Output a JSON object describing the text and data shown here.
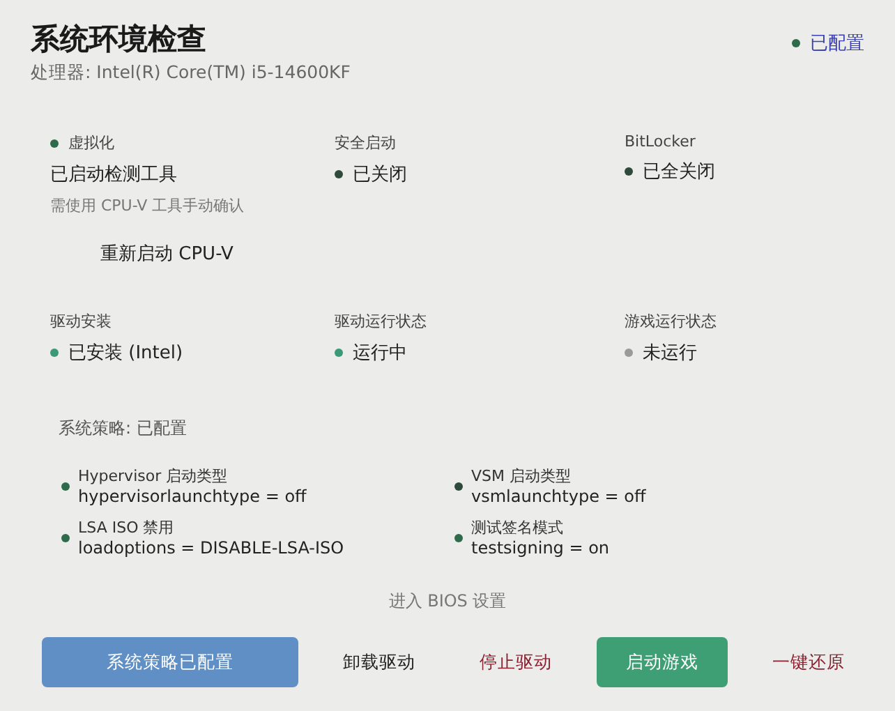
{
  "header": {
    "title": "系统环境检查",
    "processor": "处理器: Intel(R) Core(TM) i5-14600KF",
    "status": {
      "label": "已配置",
      "color": "#2e6b4a"
    }
  },
  "checks": [
    {
      "kind": "label_dot",
      "label": "虚拟化",
      "color": "#2e6b4a",
      "value": "已启动检测工具",
      "note": "需使用 CPU-V 工具手动确认",
      "action": "重新启动 CPU-V"
    },
    {
      "label": "安全启动",
      "value": "已关闭",
      "color": "#2e4a3a"
    },
    {
      "label": "BitLocker",
      "value": "已全关闭",
      "color": "#2e4a3a"
    },
    {
      "label": "驱动安装",
      "value": "已安装 (Intel)",
      "color": "#3a9a78"
    },
    {
      "label": "驱动运行状态",
      "value": "运行中",
      "color": "#3a9a78"
    },
    {
      "label": "游戏运行状态",
      "value": "未运行",
      "color": "#9a9a9a"
    }
  ],
  "policy": {
    "title": "系统策略: 已配置",
    "items": [
      {
        "name": "Hypervisor 启动类型",
        "value": "hypervisorlaunchtype = off",
        "color": "#2e6b4a"
      },
      {
        "name": "VSM 启动类型",
        "value": "vsmlaunchtype = off",
        "color": "#2e4a3a"
      },
      {
        "name": "LSA ISO 禁用",
        "value": "loadoptions = DISABLE-LSA-ISO",
        "color": "#2e6b4a"
      },
      {
        "name": "测试签名模式",
        "value": "testsigning = on",
        "color": "#2e6b4a"
      }
    ]
  },
  "bios_link": "进入 BIOS 设置",
  "buttons": [
    {
      "label": "系统策略已配置",
      "kind": "blue",
      "disabled": true
    },
    {
      "label": "卸载驱动",
      "kind": "plain",
      "disabled": false
    },
    {
      "label": "停止驱动",
      "kind": "danger",
      "disabled": false
    },
    {
      "label": "启动游戏",
      "kind": "green",
      "disabled": true
    },
    {
      "label": "一键还原",
      "kind": "danger",
      "disabled": false
    }
  ]
}
